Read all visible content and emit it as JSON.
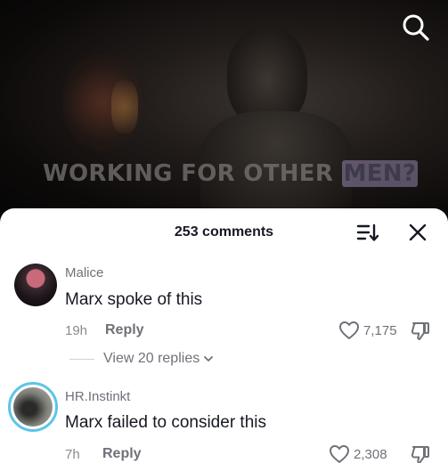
{
  "video": {
    "overlay_text": "WORKING FOR OTHER",
    "overlay_highlight": "MEN?"
  },
  "icons": {
    "search": "search-icon",
    "sort": "sort-icon",
    "close": "close-icon",
    "like": "heart-icon",
    "dislike": "dislike-icon",
    "chevron": "chevron-down-icon"
  },
  "comments_panel": {
    "count_label": "253 comments",
    "comments": [
      {
        "username": "Malice",
        "text": "Marx spoke of this",
        "time": "19h",
        "reply_label": "Reply",
        "likes": "7,175",
        "view_replies": "View 20 replies"
      },
      {
        "username": "HR.Instinkt",
        "text": "Marx failed to consider this",
        "time": "7h",
        "reply_label": "Reply",
        "likes": "2,308"
      }
    ]
  },
  "colors": {
    "sheet_bg": "#ffffff",
    "text_primary": "#161823",
    "text_secondary": "#6f7178",
    "story_ring": "#5bc6e6"
  }
}
